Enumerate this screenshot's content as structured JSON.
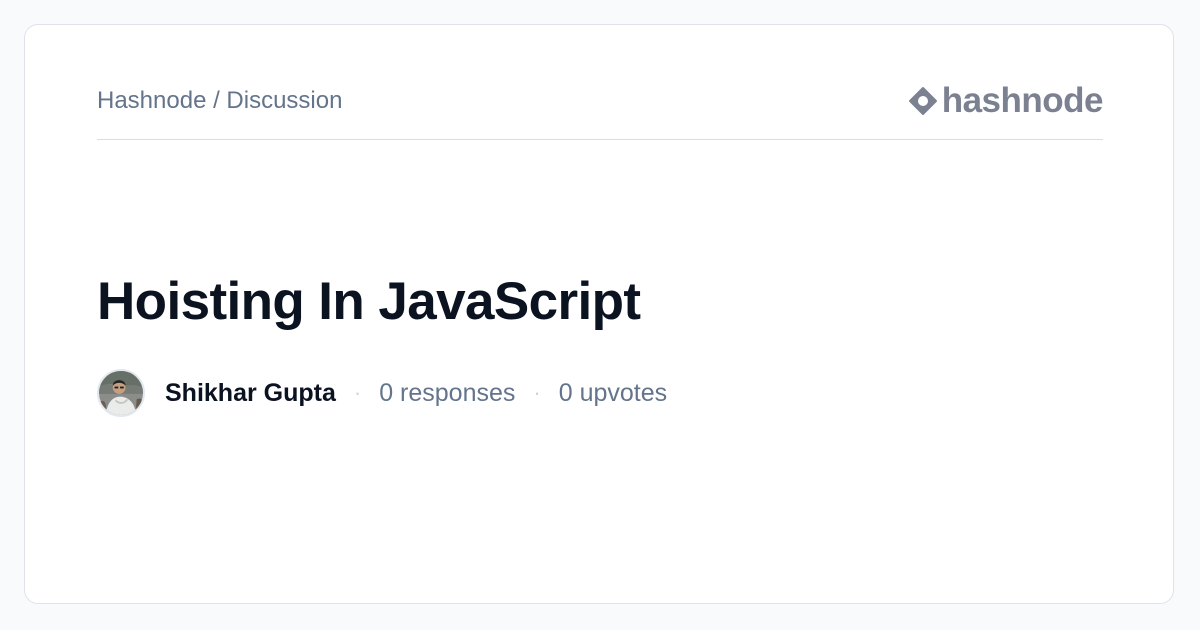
{
  "header": {
    "breadcrumb": "Hashnode / Discussion",
    "logo_text": "hashnode",
    "logo_icon": "hashnode-logo-icon"
  },
  "post": {
    "title": "Hoisting In JavaScript"
  },
  "meta": {
    "author_name": "Shikhar Gupta",
    "avatar_icon": "author-avatar",
    "separator": "·",
    "responses": "0 responses",
    "upvotes": "0 upvotes"
  },
  "colors": {
    "page_background": "#f8fafc",
    "card_background": "#ffffff",
    "title_text": "#0b1220",
    "muted_text": "#64748b",
    "logo": "#7b8190"
  }
}
